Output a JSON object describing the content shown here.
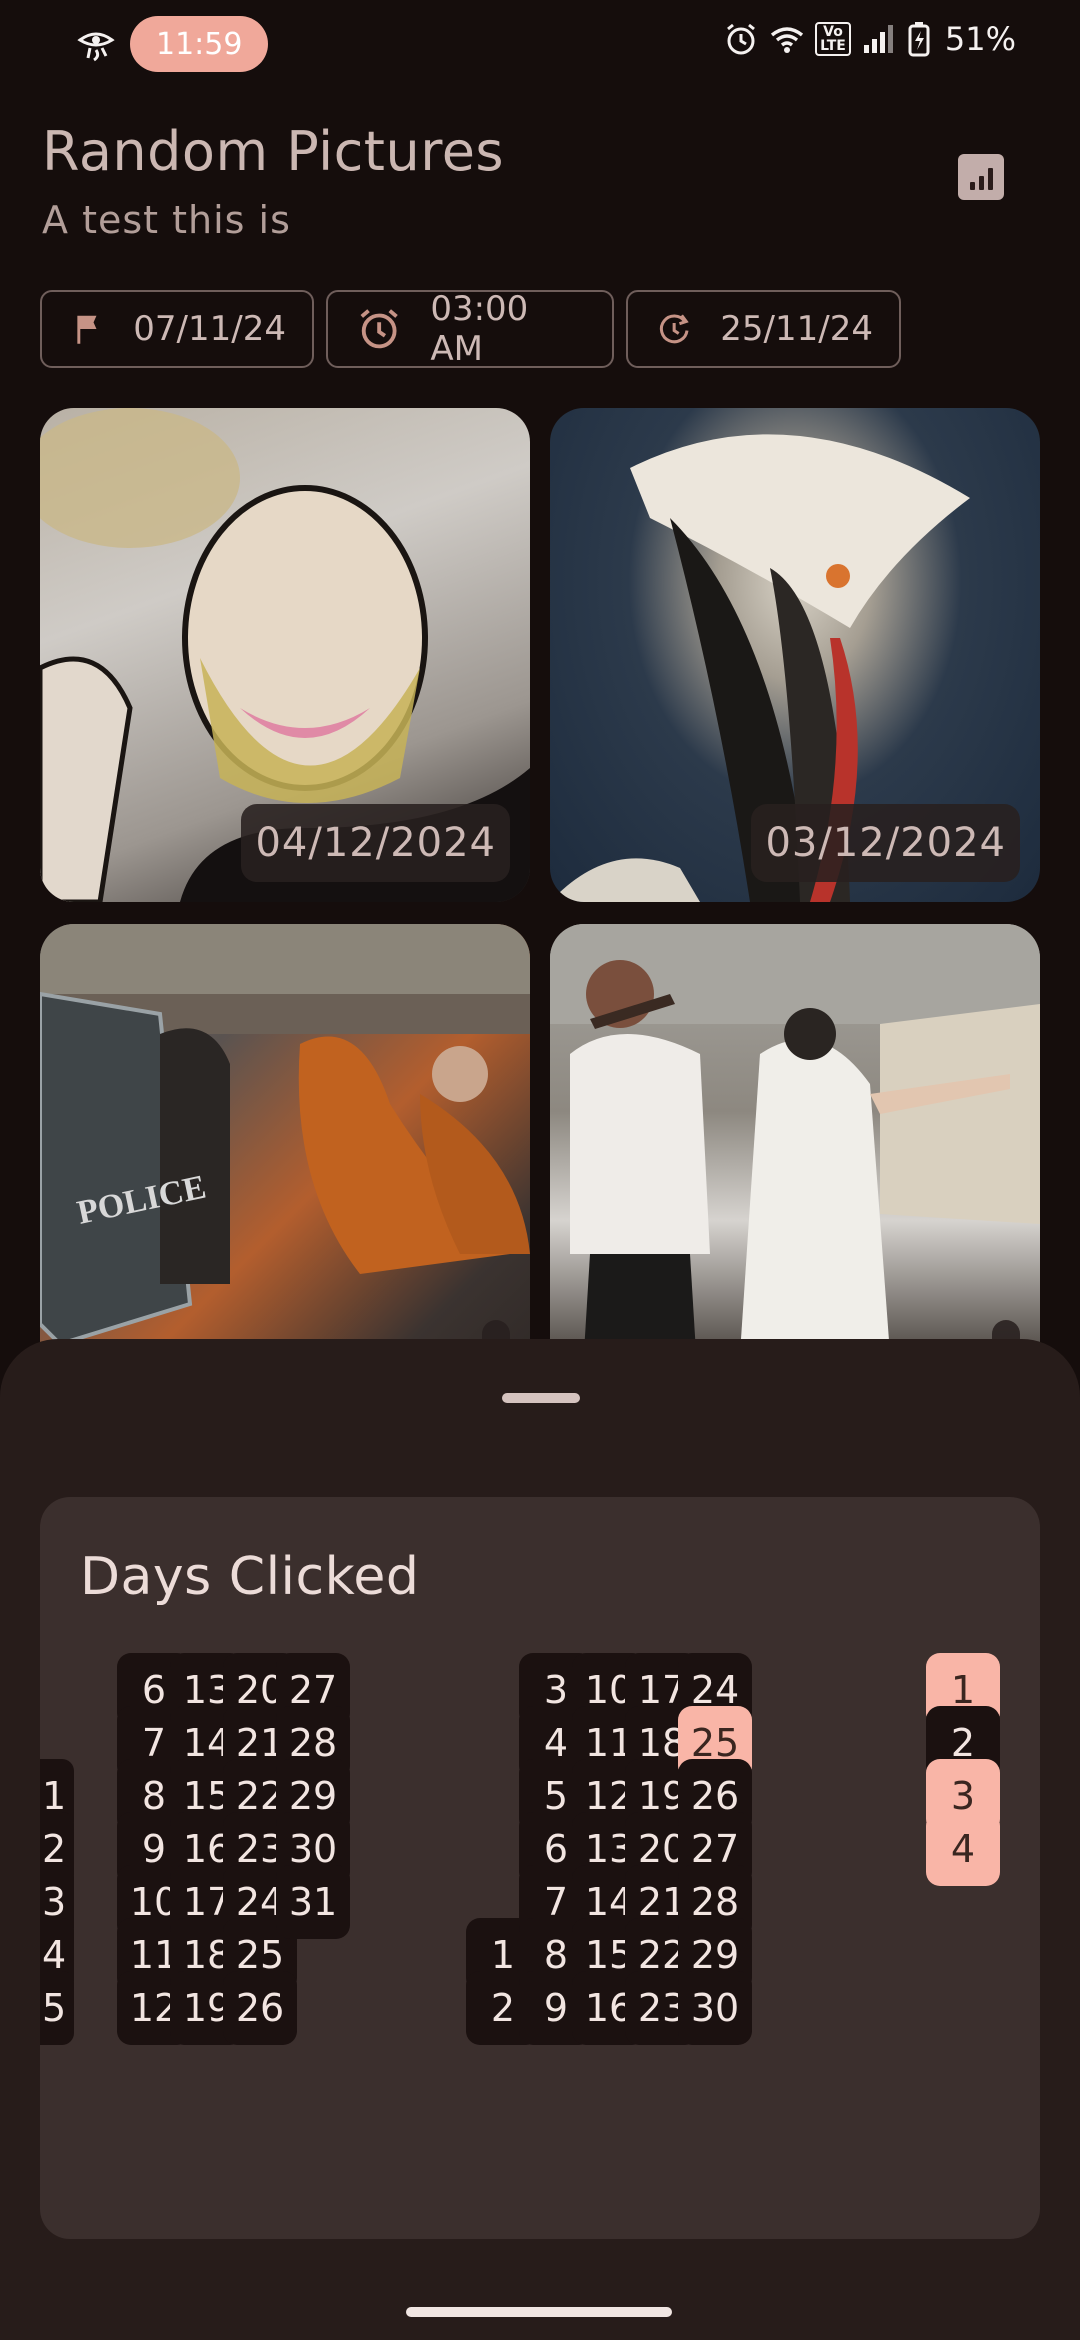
{
  "status_bar": {
    "time": "11:59",
    "battery": "51%",
    "network": "VoLTE",
    "icons": [
      "eye-icon",
      "alarm-icon",
      "wifi-icon",
      "volte-icon",
      "signal-icon",
      "battery-charging-icon"
    ]
  },
  "header": {
    "title": "Random Pictures",
    "subtitle": "A test this is",
    "stats_icon": "bar-chart-icon"
  },
  "chips": [
    {
      "icon": "flag-icon",
      "label": "07/11/24"
    },
    {
      "icon": "alarm-icon",
      "label": "03:00 AM"
    },
    {
      "icon": "refresh-clock-icon",
      "label": "25/11/24"
    }
  ],
  "photos": [
    {
      "date": "04/12/2024"
    },
    {
      "date": "03/12/2024"
    },
    {
      "date": ""
    },
    {
      "date": ""
    }
  ],
  "sheet": {
    "title": "Days Clicked",
    "accent_color": "#f9b5a7",
    "month1": {
      "columns": [
        [
          "",
          "",
          "1",
          "2",
          "3",
          "4",
          "5"
        ],
        [
          "6",
          "7",
          "8",
          "9",
          "10",
          "11",
          "12"
        ],
        [
          "13",
          "14",
          "15",
          "16",
          "17",
          "18",
          "19"
        ],
        [
          "20",
          "21",
          "22",
          "23",
          "24",
          "25",
          "26"
        ],
        [
          "27",
          "28",
          "29",
          "30",
          "31",
          "",
          ""
        ]
      ],
      "selected": []
    },
    "month2": {
      "columns": [
        [
          "",
          "",
          "",
          "",
          "",
          "1",
          "2"
        ],
        [
          "3",
          "4",
          "5",
          "6",
          "7",
          "8",
          "9"
        ],
        [
          "10",
          "11",
          "12",
          "13",
          "14",
          "15",
          "16"
        ],
        [
          "17",
          "18",
          "19",
          "20",
          "21",
          "22",
          "23"
        ],
        [
          "24",
          "25",
          "26",
          "27",
          "28",
          "29",
          "30"
        ]
      ],
      "selected": [
        "25"
      ]
    },
    "month3": {
      "columns": [
        [
          "1",
          "2",
          "3",
          "4"
        ]
      ],
      "selected": [
        "1",
        "3",
        "4"
      ]
    }
  }
}
